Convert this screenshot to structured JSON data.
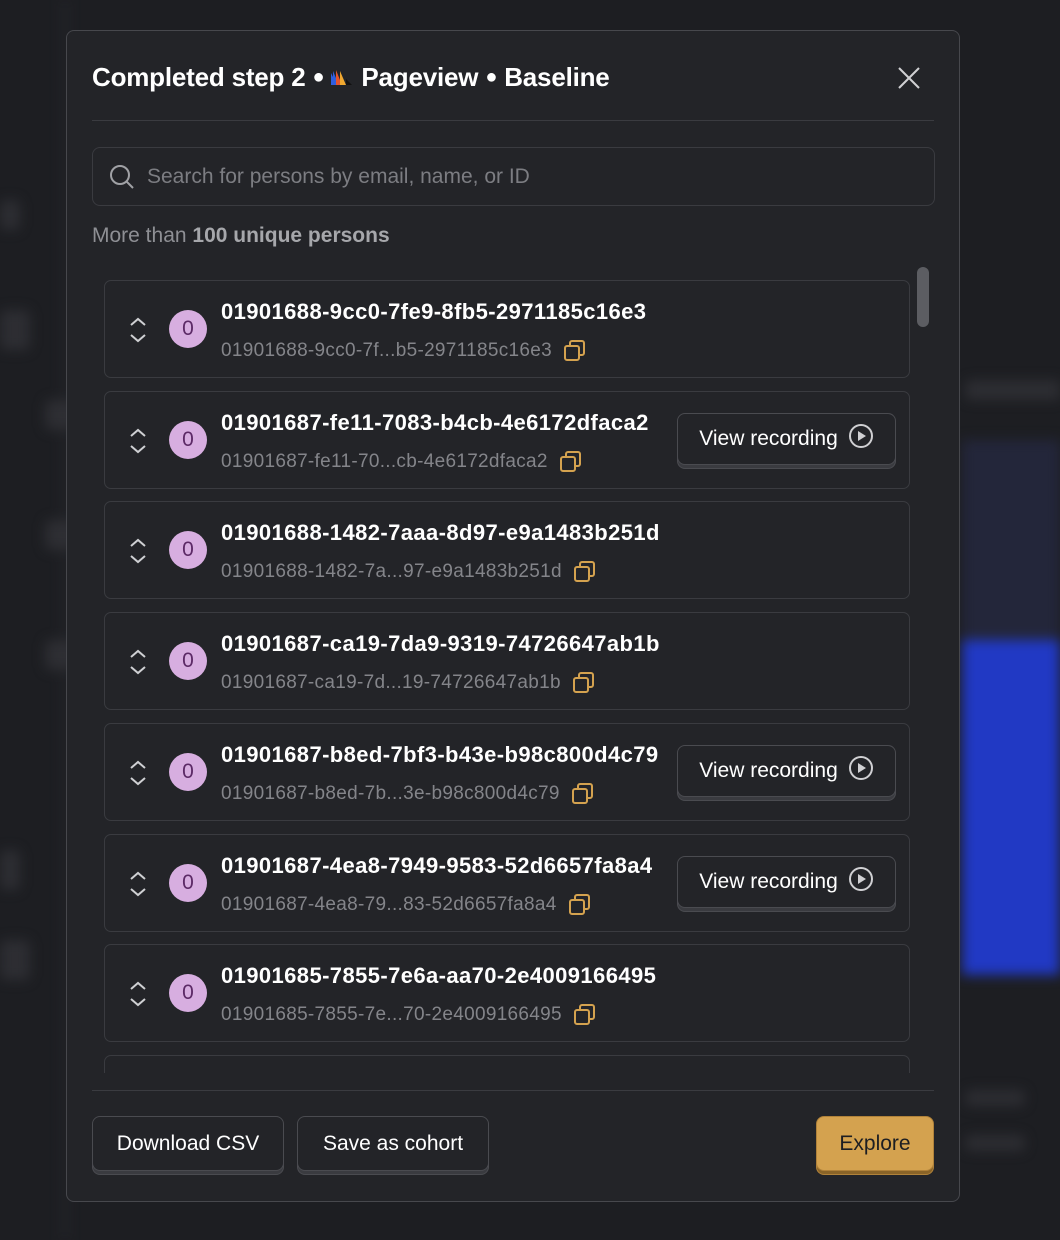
{
  "modal": {
    "title_prefix": "Completed step 2",
    "event_name": "Pageview",
    "variant": "Baseline",
    "separator": "●",
    "close_icon": "close-icon"
  },
  "search": {
    "placeholder": "Search for persons by email, name, or ID",
    "value": ""
  },
  "count": {
    "prefix": "More than",
    "bold": "100 unique persons"
  },
  "persons": [
    {
      "name": "01901688-9cc0-7fe9-8fb5-2971185c16e3",
      "id_short": "01901688-9cc0-7f...b5-2971185c16e3",
      "avatar": "0",
      "has_recording": false
    },
    {
      "name": "01901687-fe11-7083-b4cb-4e6172dfaca2",
      "id_short": "01901687-fe11-70...cb-4e6172dfaca2",
      "avatar": "0",
      "has_recording": true
    },
    {
      "name": "01901688-1482-7aaa-8d97-e9a1483b251d",
      "id_short": "01901688-1482-7a...97-e9a1483b251d",
      "avatar": "0",
      "has_recording": false
    },
    {
      "name": "01901687-ca19-7da9-9319-74726647ab1b",
      "id_short": "01901687-ca19-7d...19-74726647ab1b",
      "avatar": "0",
      "has_recording": false
    },
    {
      "name": "01901687-b8ed-7bf3-b43e-b98c800d4c79",
      "id_short": "01901687-b8ed-7b...3e-b98c800d4c79",
      "avatar": "0",
      "has_recording": true
    },
    {
      "name": "01901687-4ea8-7949-9583-52d6657fa8a4",
      "id_short": "01901687-4ea8-79...83-52d6657fa8a4",
      "avatar": "0",
      "has_recording": true
    },
    {
      "name": "01901685-7855-7e6a-aa70-2e4009166495",
      "id_short": "01901685-7855-7e...70-2e4009166495",
      "avatar": "0",
      "has_recording": false
    }
  ],
  "row_actions": {
    "view_recording": "View recording"
  },
  "footer": {
    "download_csv": "Download CSV",
    "save_cohort": "Save as cohort",
    "explore": "Explore"
  },
  "colors": {
    "accent": "#d4a24f",
    "avatar_bg": "#d7aee0",
    "copy_icon": "#d4a24f",
    "modal_bg": "#232428"
  }
}
